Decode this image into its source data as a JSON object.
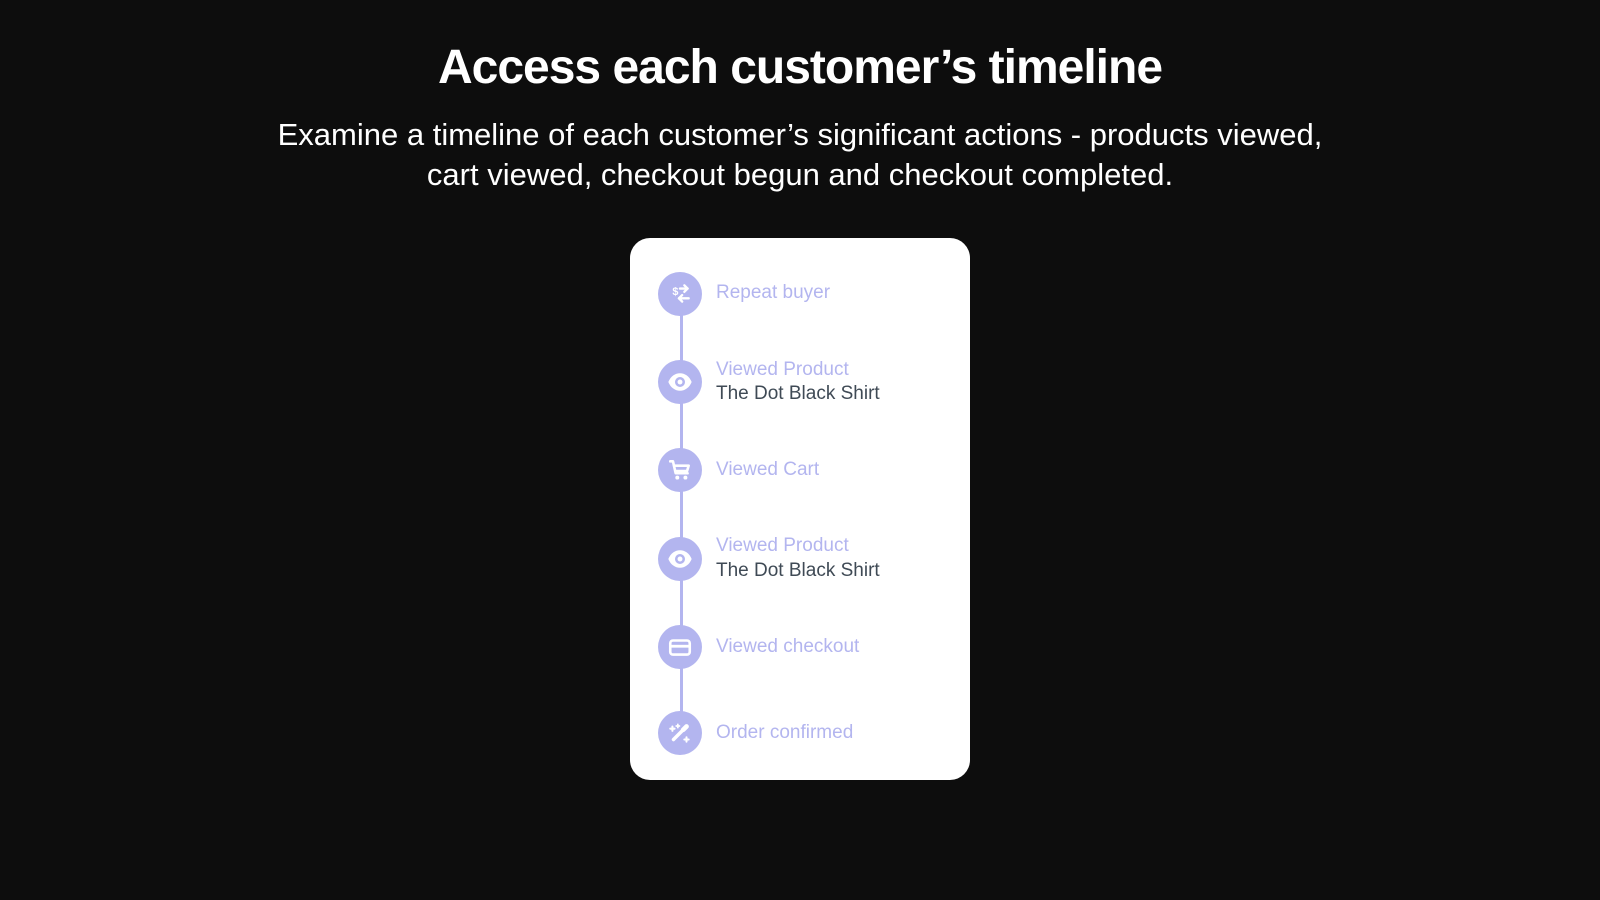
{
  "headline": "Access each customer’s timeline",
  "subhead": "Examine a timeline of each customer’s significant actions - products viewed, cart viewed, checkout begun and checkout completed.",
  "colors": {
    "background": "#0d0d0d",
    "card": "#ffffff",
    "accent": "#b3b5ef",
    "textDark": "#3f4a55",
    "textLight": "#ffffff"
  },
  "timeline": [
    {
      "icon": "dollar-swap-icon",
      "label": "Repeat buyer",
      "detail": null
    },
    {
      "icon": "eye-icon",
      "label": "Viewed Product",
      "detail": "The Dot Black Shirt"
    },
    {
      "icon": "cart-icon",
      "label": "Viewed Cart",
      "detail": null
    },
    {
      "icon": "eye-icon",
      "label": "Viewed Product",
      "detail": "The Dot Black Shirt"
    },
    {
      "icon": "card-icon",
      "label": "Viewed checkout",
      "detail": null
    },
    {
      "icon": "sparkle-icon",
      "label": "Order confirmed",
      "detail": null
    }
  ]
}
